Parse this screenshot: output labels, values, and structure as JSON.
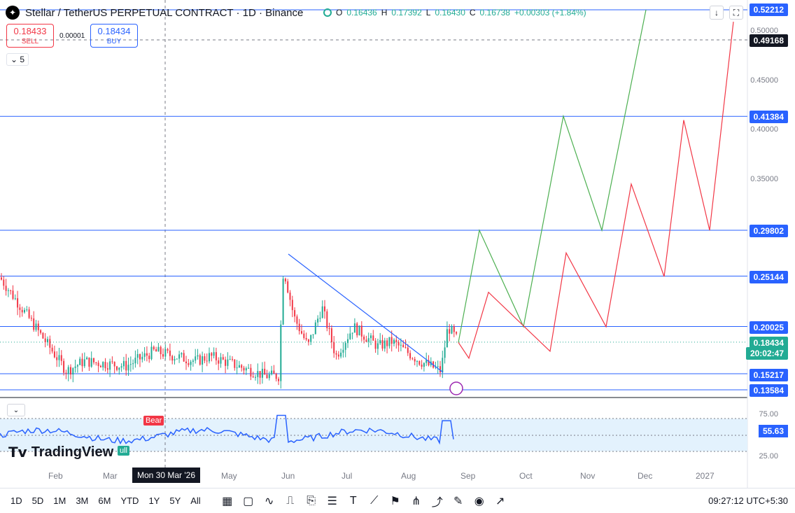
{
  "header": {
    "symbol_title": "Stellar / TetherUS PERPETUAL CONTRACT · 1D · Binance",
    "ohlc": {
      "o_label": "O",
      "o": "0.16436",
      "h_label": "H",
      "h": "0.17392",
      "l_label": "L",
      "l": "0.16430",
      "c_label": "C",
      "c": "0.16738",
      "change": "+0.00303 (+1.84%)"
    }
  },
  "trade": {
    "sell_price": "0.18433",
    "sell_label": "SELL",
    "buy_price": "0.18434",
    "buy_label": "BUY",
    "spread": "0.00001",
    "lots": "5"
  },
  "price_axis": {
    "labels": [
      "0.50000",
      "0.45000",
      "0.40000",
      "0.35000"
    ],
    "tags": [
      {
        "value": "0.52212",
        "color": "#2962ff"
      },
      {
        "value": "0.49168",
        "color": "#131722"
      },
      {
        "value": "0.41384",
        "color": "#2962ff"
      },
      {
        "value": "0.29802",
        "color": "#2962ff"
      },
      {
        "value": "0.25144",
        "color": "#2962ff"
      },
      {
        "value": "0.20025",
        "color": "#2962ff"
      },
      {
        "value": "0.18434",
        "color": "#22ab94"
      },
      {
        "value": "20:02:47",
        "color": "#22ab94"
      },
      {
        "value": "0.15217",
        "color": "#2962ff"
      },
      {
        "value": "0.13584",
        "color": "#2962ff"
      }
    ]
  },
  "time_axis": {
    "labels": [
      "Feb",
      "Mar",
      "May",
      "Jun",
      "Jul",
      "Aug",
      "Sep",
      "Oct",
      "Nov",
      "Dec",
      "2027"
    ],
    "crosshair_date": "Mon 30 Mar '26"
  },
  "rsi": {
    "value": "55.63",
    "levels": [
      "75.00",
      "25.00"
    ],
    "bear_label": "Bear",
    "bull_label": "ull"
  },
  "brand": {
    "name": "TradingView"
  },
  "toolbar": {
    "timeframes": [
      "1D",
      "5D",
      "1M",
      "3M",
      "6M",
      "YTD",
      "1Y",
      "5Y",
      "All"
    ],
    "clock": "09:27:12 UTC+5:30"
  },
  "colors": {
    "up": "#22ab94",
    "down": "#f23645",
    "line": "#2962ff",
    "green_path": "#4caf50",
    "red_path": "#f23645"
  },
  "chart_data": {
    "type": "candlestick",
    "title": "Stellar / TetherUS PERPETUAL CONTRACT · 1D · Binance",
    "horizontal_levels": [
      0.52212,
      0.41384,
      0.29802,
      0.25144,
      0.20025,
      0.15217,
      0.13584
    ],
    "last_price": 0.18434,
    "green_projection": [
      0.184,
      0.298,
      0.2,
      0.414,
      0.298,
      0.522
    ],
    "red_projection": [
      0.184,
      0.168,
      0.235,
      0.175,
      0.275,
      0.2,
      0.345,
      0.251,
      0.41,
      0.298,
      0.51
    ],
    "y_range": [
      0.125,
      0.53
    ],
    "x_range": [
      "Jan 2026",
      "Jan 2027"
    ]
  }
}
